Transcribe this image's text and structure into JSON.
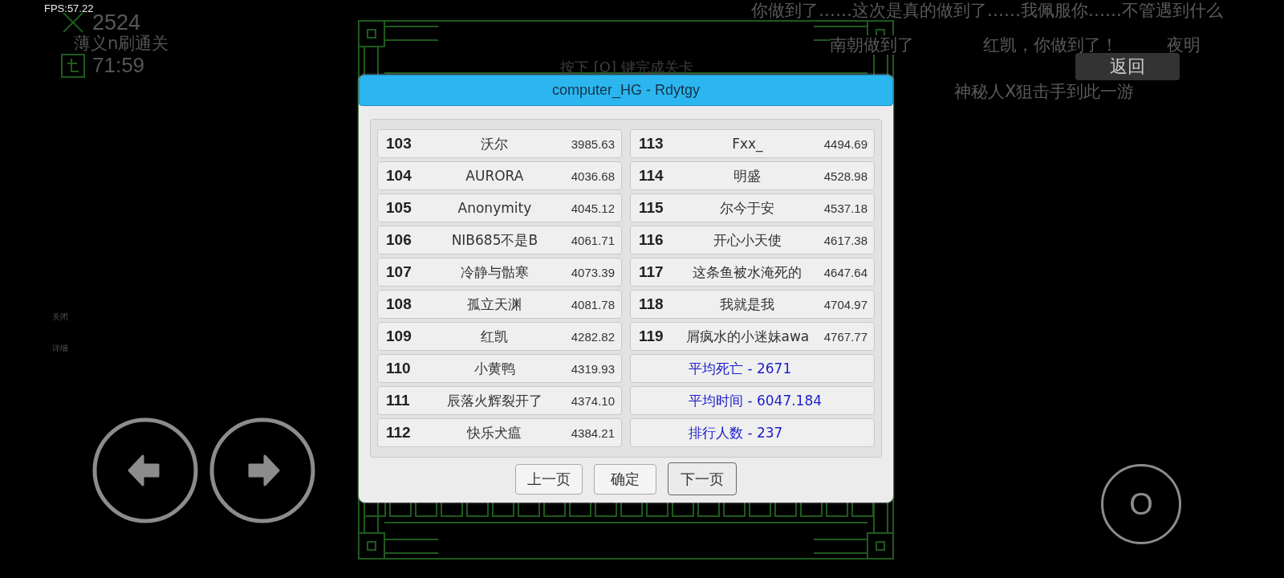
{
  "hud": {
    "fps": "FPS:57.22",
    "kills": "2524",
    "level_name": "薄义n刷通关",
    "time": "71:59"
  },
  "messages": [
    {
      "text": "你做到了……这次是真的做到了……我佩服你……不管遇到什么"
    },
    {
      "text": "南朝做到了"
    },
    {
      "text": "红凯，你做到了！"
    },
    {
      "text": "夜明"
    },
    {
      "text": "神秘人X狙击手到此一游"
    }
  ],
  "hint": "按下 [O] 键完成关卡",
  "back_button": "返回",
  "side_links": [
    "关闭",
    "详细"
  ],
  "dialog": {
    "title": "computer_HG - Rdytgy",
    "left_rows": [
      {
        "rank": "103",
        "name": "沃尔",
        "score": "3985.63"
      },
      {
        "rank": "104",
        "name": "AURORA",
        "score": "4036.68"
      },
      {
        "rank": "105",
        "name": "Anonymity",
        "score": "4045.12"
      },
      {
        "rank": "106",
        "name": "NIB685不是B",
        "score": "4061.71"
      },
      {
        "rank": "107",
        "name": "冷静与骷寒",
        "score": "4073.39"
      },
      {
        "rank": "108",
        "name": "孤立天渊",
        "score": "4081.78"
      },
      {
        "rank": "109",
        "name": "红凯",
        "score": "4282.82"
      },
      {
        "rank": "110",
        "name": "小黄鸭",
        "score": "4319.93"
      },
      {
        "rank": "111",
        "name": "辰落火辉裂开了",
        "score": "4374.10"
      },
      {
        "rank": "112",
        "name": "快乐犬瘟",
        "score": "4384.21"
      }
    ],
    "right_rows": [
      {
        "rank": "113",
        "name": "Fxx_",
        "score": "4494.69"
      },
      {
        "rank": "114",
        "name": "明盛",
        "score": "4528.98"
      },
      {
        "rank": "115",
        "name": "尔今于安",
        "score": "4537.18"
      },
      {
        "rank": "116",
        "name": "开心小天使",
        "score": "4617.38"
      },
      {
        "rank": "117",
        "name": "这条鱼被水淹死的",
        "score": "4647.64"
      },
      {
        "rank": "118",
        "name": "我就是我",
        "score": "4704.97"
      },
      {
        "rank": "119",
        "name": "屑疯水的小迷妹awa",
        "score": "4767.77"
      }
    ],
    "stats": [
      "平均死亡 - 2671",
      "平均时间 - 6047.184",
      "排行人数 - 237"
    ],
    "buttons": [
      {
        "label": "上一页",
        "focused": false
      },
      {
        "label": "确定",
        "focused": false
      },
      {
        "label": "下一页",
        "focused": true
      }
    ]
  },
  "controls": {
    "action_key": "O"
  }
}
